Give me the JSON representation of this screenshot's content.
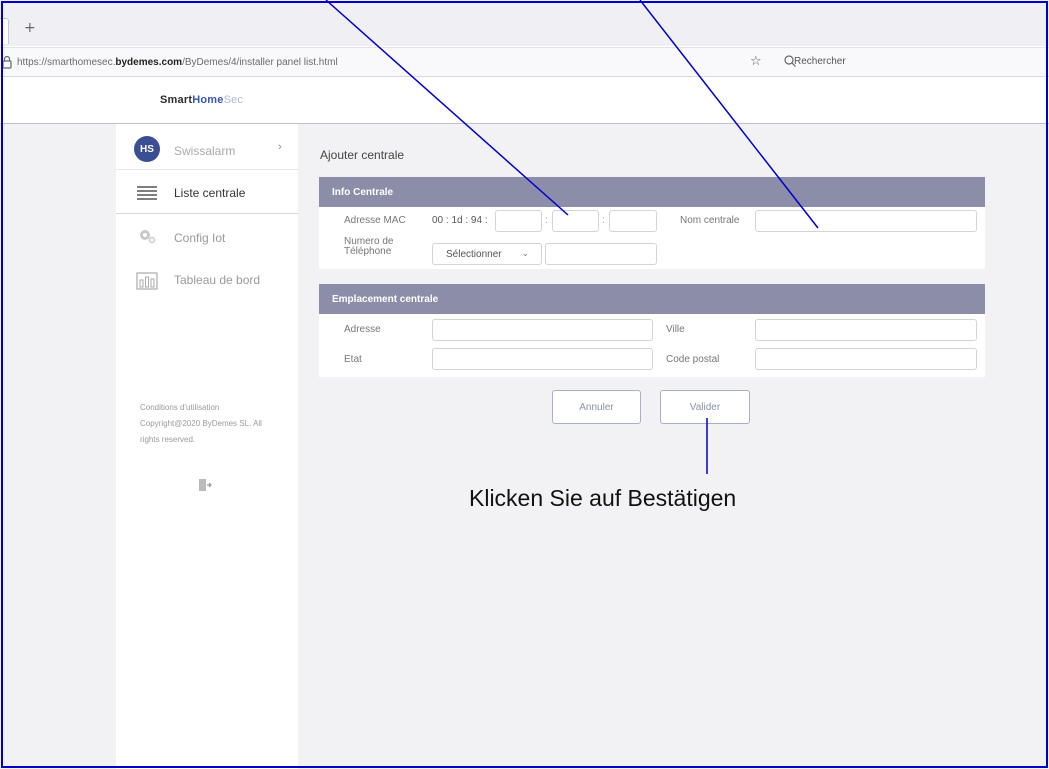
{
  "browser": {
    "newtab_glyph": "+",
    "url_prefix": "https://smarthomesec.",
    "url_domain": "bydemes.com",
    "url_path": "/ByDemes/4/installer panel list.html",
    "search_placeholder": "Rechercher"
  },
  "brand": {
    "part1": "Smart",
    "part2": "Home",
    "part3": "Sec"
  },
  "sidebar": {
    "avatar_initials": "HS",
    "user_name": "Swissalarm",
    "chevron": "›",
    "items": [
      {
        "label": "Liste centrale",
        "icon": "list-icon",
        "active": true
      },
      {
        "label": "Config Iot",
        "icon": "gear-icon",
        "active": false
      },
      {
        "label": "Tableau de bord",
        "icon": "dashboard-icon",
        "active": false
      }
    ],
    "terms_line1": "Conditions d'utilisation",
    "terms_line2": "Copyright@2020 ByDemes SL. All",
    "terms_line3": "rights reserved."
  },
  "main": {
    "page_title": "Ajouter centrale",
    "info_panel": {
      "title": "Info Centrale",
      "mac_label": "Adresse MAC",
      "mac_prefix": "00 : 1d : 94 :",
      "mac_separator": ":",
      "name_label": "Nom centrale",
      "phone_label_line1": "Numero de",
      "phone_label_line2": "Téléphone",
      "phone_select_value": "Sélectionner",
      "phone_select_chevron": "⌄"
    },
    "location_panel": {
      "title": "Emplacement centrale",
      "address_label": "Adresse",
      "city_label": "Ville",
      "state_label": "Etat",
      "postal_label": "Code postal"
    },
    "buttons": {
      "cancel": "Annuler",
      "submit": "Valider"
    }
  },
  "annotation": {
    "callout_text": "Klicken Sie auf Bestätigen",
    "line_color": "#0000cc"
  }
}
